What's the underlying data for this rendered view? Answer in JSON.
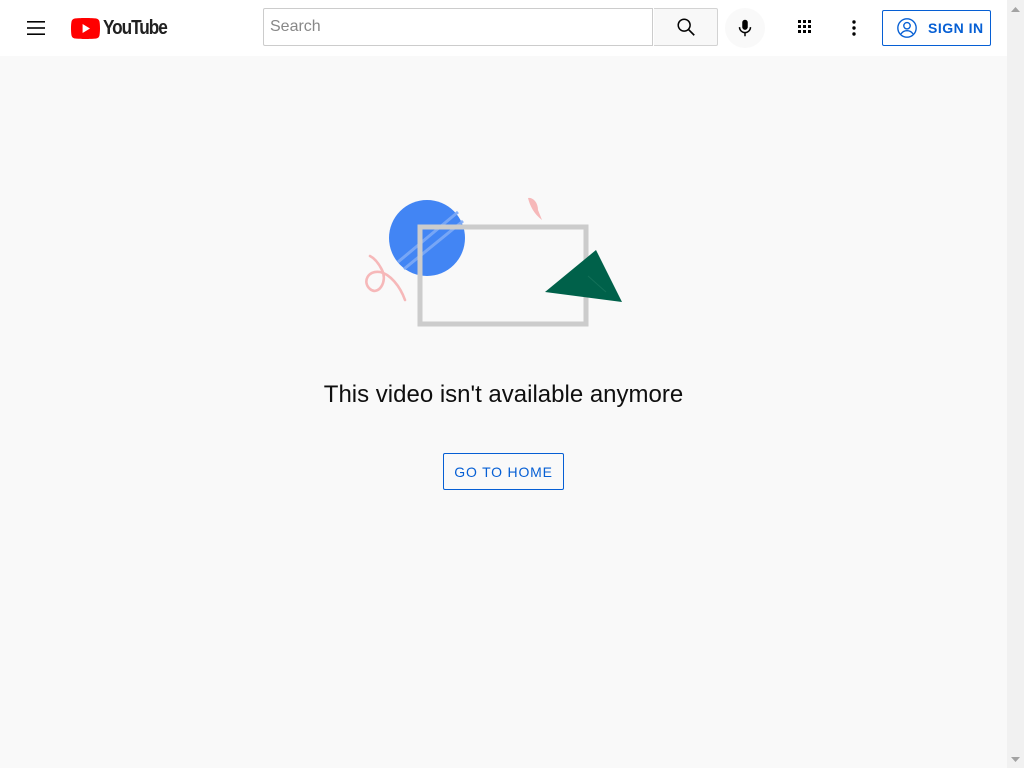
{
  "masthead": {
    "logo_text": "YouTube",
    "search": {
      "placeholder": "Search",
      "value": ""
    },
    "sign_in_label": "SIGN IN",
    "icons": {
      "menu": "hamburger-menu-icon",
      "search": "search-icon",
      "mic": "microphone-icon",
      "apps": "apps-grid-icon",
      "more": "more-vertical-icon",
      "account": "account-circle-icon"
    }
  },
  "main": {
    "message": "This video isn't available anymore",
    "home_button_label": "GO TO HOME"
  },
  "colors": {
    "brand_red": "#ff0000",
    "link_blue": "#065fd4",
    "background": "#f9f9f9",
    "illustration_blue": "#4285f4",
    "illustration_green": "#00614a",
    "illustration_pink": "#f6b8b9",
    "frame_gray": "#cccccc"
  }
}
